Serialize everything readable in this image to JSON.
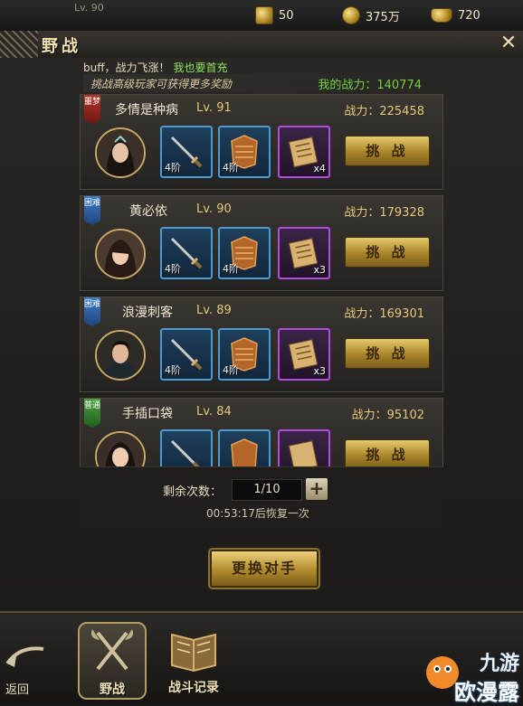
{
  "topbar": {
    "level": "Lv. 90",
    "resources": [
      {
        "icon": "token-icon",
        "value": "50"
      },
      {
        "icon": "coin-icon",
        "value": "375万"
      },
      {
        "icon": "ingot-icon",
        "value": "720"
      }
    ]
  },
  "window": {
    "title": "野战",
    "close_icon": "close-icon"
  },
  "notice": {
    "buff": "buff，战力飞涨！",
    "link": "我也要首充"
  },
  "subline": {
    "hint": "挑战高级玩家可获得更多奖励",
    "my_power": "我的战力：140774"
  },
  "opponents": [
    {
      "tag": "噩梦",
      "tag_color": "#b3322a",
      "name": "多情是种病",
      "level": "Lv. 91",
      "power": "战力：225458",
      "items": [
        {
          "kind": "sword",
          "label": "4阶"
        },
        {
          "kind": "armor",
          "label": "4阶"
        },
        {
          "kind": "scroll",
          "count": "x4"
        }
      ],
      "button": "挑 战"
    },
    {
      "tag": "困难",
      "tag_color": "#3f7fc9",
      "name": "黄必依",
      "level": "Lv. 90",
      "power": "战力：179328",
      "items": [
        {
          "kind": "sword",
          "label": "4阶"
        },
        {
          "kind": "armor",
          "label": "4阶"
        },
        {
          "kind": "scroll",
          "count": "x3"
        }
      ],
      "button": "挑 战"
    },
    {
      "tag": "困难",
      "tag_color": "#3f7fc9",
      "name": "浪漫刺客",
      "level": "Lv. 89",
      "power": "战力：169301",
      "items": [
        {
          "kind": "sword",
          "label": "4阶"
        },
        {
          "kind": "armor",
          "label": "4阶"
        },
        {
          "kind": "scroll",
          "count": "x3"
        }
      ],
      "button": "挑 战"
    },
    {
      "tag": "普通",
      "tag_color": "#4aa343",
      "name": "手插口袋",
      "level": "Lv. 84",
      "power": "战力：95102",
      "items": [
        {
          "kind": "sword",
          "label": ""
        },
        {
          "kind": "armor",
          "label": ""
        },
        {
          "kind": "scroll",
          "count": ""
        }
      ],
      "button": "挑 战"
    }
  ],
  "remaining": {
    "label": "剩余次数：",
    "value": "1/10",
    "plus": "+",
    "recover": "00:53:17后恢复一次"
  },
  "change_button": "更换对手",
  "nav": {
    "back": "返回",
    "field_battle": "野战",
    "battle_record": "战斗记录"
  },
  "watermark": {
    "line1": "九游",
    "line2": "欧漫露"
  }
}
